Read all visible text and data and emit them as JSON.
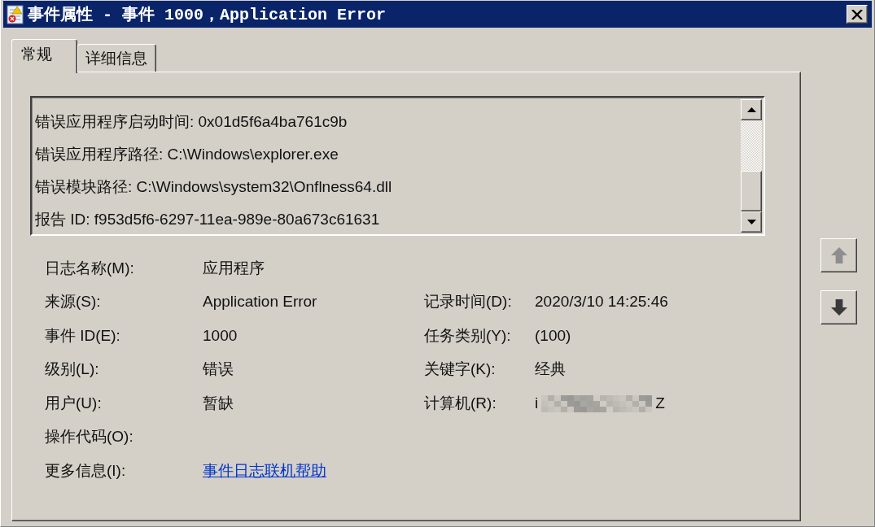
{
  "window": {
    "title": "事件属性 - 事件 1000，Application Error"
  },
  "tabs": [
    {
      "label": "常规",
      "selected": true
    },
    {
      "label": "详细信息",
      "selected": false
    }
  ],
  "description_lines": [
    "错误应用程序启动时间: 0x01d5f6a4ba761c9b",
    "错误应用程序路径: C:\\Windows\\explorer.exe",
    "错误模块路径: C:\\Windows\\system32\\Onflness64.dll",
    "报告 ID: f953d5f6-6297-11ea-989e-80a673c61631"
  ],
  "field_rows": [
    {
      "cells": [
        {
          "kind": "text",
          "label": "日志名称(M):",
          "value": "应用程序"
        }
      ]
    },
    {
      "cells": [
        {
          "kind": "text",
          "label": "来源(S):",
          "value": "Application Error"
        },
        {
          "kind": "text",
          "label": "记录时间(D):",
          "value": "2020/3/10 14:25:46"
        }
      ]
    },
    {
      "cells": [
        {
          "kind": "text",
          "label": "事件 ID(E):",
          "value": "1000"
        },
        {
          "kind": "text",
          "label": "任务类别(Y):",
          "value": "(100)"
        }
      ]
    },
    {
      "cells": [
        {
          "kind": "text",
          "label": "级别(L):",
          "value": "错误"
        },
        {
          "kind": "text",
          "label": "关键字(K):",
          "value": "经典"
        }
      ]
    },
    {
      "cells": [
        {
          "kind": "text",
          "label": "用户(U):",
          "value": "暂缺"
        },
        {
          "kind": "redacted",
          "label": "计算机(R):",
          "value_start": "i",
          "value_end": "Z"
        }
      ]
    },
    {
      "cells": [
        {
          "kind": "text",
          "label": "操作代码(O):"
        }
      ]
    },
    {
      "cells": [
        {
          "kind": "link",
          "label": "更多信息(I):",
          "value": "事件日志联机帮助"
        }
      ]
    }
  ],
  "nav_buttons": [
    {
      "kind": "up",
      "disabled": true
    },
    {
      "kind": "down",
      "disabled": false
    }
  ]
}
